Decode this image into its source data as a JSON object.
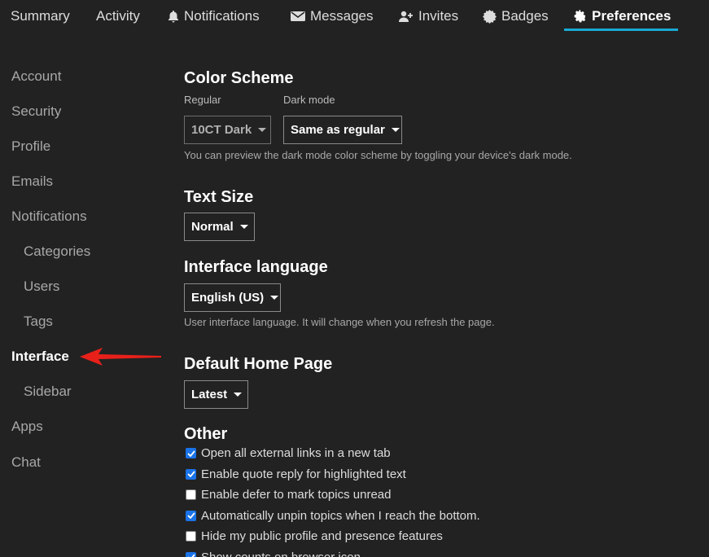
{
  "nav": {
    "tabs": [
      {
        "label": "Summary",
        "icon": null
      },
      {
        "label": "Activity",
        "icon": null
      },
      {
        "label": "Notifications",
        "icon": "bell-icon"
      },
      {
        "label": "Messages",
        "icon": "envelope-icon"
      },
      {
        "label": "Invites",
        "icon": "user-plus-icon"
      },
      {
        "label": "Badges",
        "icon": "certificate-icon"
      },
      {
        "label": "Preferences",
        "icon": "gear-icon"
      }
    ],
    "active": "Preferences",
    "accent": "#19a9d5"
  },
  "sidebar": {
    "items": [
      {
        "label": "Account"
      },
      {
        "label": "Security"
      },
      {
        "label": "Profile"
      },
      {
        "label": "Emails"
      },
      {
        "label": "Notifications"
      },
      {
        "label": "Categories"
      },
      {
        "label": "Users"
      },
      {
        "label": "Tags"
      },
      {
        "label": "Interface"
      },
      {
        "label": "Sidebar"
      },
      {
        "label": "Apps"
      },
      {
        "label": "Chat"
      }
    ],
    "active": "Interface",
    "annotation_color": "#e8201a"
  },
  "main": {
    "color_scheme": {
      "title": "Color Scheme",
      "regular_label": "Regular",
      "regular_value": "10CT Dark",
      "dark_label": "Dark mode",
      "dark_value": "Same as regular",
      "help": "You can preview the dark mode color scheme by toggling your device's dark mode."
    },
    "text_size": {
      "title": "Text Size",
      "value": "Normal"
    },
    "interface_language": {
      "title": "Interface language",
      "value": "English (US)",
      "help": "User interface language. It will change when you refresh the page."
    },
    "home_page": {
      "title": "Default Home Page",
      "value": "Latest"
    },
    "other": {
      "title": "Other",
      "options": [
        {
          "label": "Open all external links in a new tab",
          "checked": true
        },
        {
          "label": "Enable quote reply for highlighted text",
          "checked": true
        },
        {
          "label": "Enable defer to mark topics unread",
          "checked": false
        },
        {
          "label": "Automatically unpin topics when I reach the bottom.",
          "checked": true
        },
        {
          "label": "Hide my public profile and presence features",
          "checked": false
        },
        {
          "label": "Show counts on browser icon",
          "checked": true
        }
      ]
    }
  }
}
